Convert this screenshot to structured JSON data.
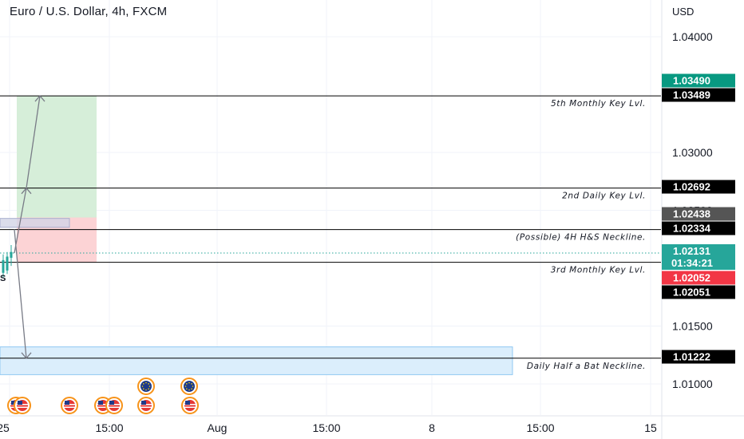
{
  "header": {
    "title": "Euro / U.S. Dollar, 4h, FXCM",
    "currency": "USD"
  },
  "chart_data": {
    "type": "line",
    "symbol": "Euro / U.S. Dollar, 4h, FXCM",
    "y_axis_label": "USD",
    "ylim": [
      1.0085,
      1.0445
    ],
    "y_ticks": [
      {
        "value": 1.04,
        "label": "1.04000"
      },
      {
        "value": 1.03,
        "label": "1.03000"
      },
      {
        "value": 1.025,
        "label": "1.02500"
      },
      {
        "value": 1.015,
        "label": "1.01500"
      },
      {
        "value": 1.01,
        "label": "1.01000"
      }
    ],
    "x_ticks": [
      "25",
      "15:00",
      "Aug",
      "15:00",
      "8",
      "15:00",
      "15"
    ],
    "horizontal_levels": [
      {
        "value": 1.03489,
        "label": "5th Monthly Key Lvl."
      },
      {
        "value": 1.02692,
        "label": "2nd Daily Key Lvl."
      },
      {
        "value": 1.02334,
        "label": "(Possible) 4H H&S Neckline."
      },
      {
        "value": 1.02051,
        "label": "3rd Monthly Key Lvl."
      },
      {
        "value": 1.01222,
        "label": "Daily Half a Bat Neckline."
      }
    ],
    "price_tags": [
      {
        "value": 1.0349,
        "label": "1.03490",
        "color": "#089981"
      },
      {
        "value": 1.03489,
        "label": "1.03489",
        "color": "#000000"
      },
      {
        "value": 1.02692,
        "label": "1.02692",
        "color": "#000000"
      },
      {
        "value": 1.02438,
        "label": "1.02438",
        "color": "#555555"
      },
      {
        "value": 1.02334,
        "label": "1.02334",
        "color": "#000000"
      },
      {
        "value": 1.02131,
        "label": "1.02131",
        "sublabel": "01:34:21",
        "color": "#26a69a"
      },
      {
        "value": 1.02052,
        "label": "1.02052",
        "color": "#f23645"
      },
      {
        "value": 1.02051,
        "label": "1.02051",
        "color": "#000000"
      },
      {
        "value": 1.01222,
        "label": "1.01222",
        "color": "#000000"
      }
    ],
    "current_price": 1.02131,
    "countdown": "01:34:21",
    "position": {
      "entry": 1.02438,
      "target": 1.03489,
      "stop": 1.02051
    },
    "zones": [
      {
        "name": "daily-half-bat-zone",
        "top": 1.0132,
        "bottom": 1.0108
      },
      {
        "name": "neckline-zone",
        "top": 1.0243,
        "bottom": 1.0236
      }
    ],
    "projection_path": [
      1.02131,
      1.02692,
      1.03489
    ],
    "down_projection": [
      1.02334,
      1.01222
    ],
    "partial_label": "S",
    "colors": {
      "profit": "#d6eed9",
      "loss": "#fcd3d5",
      "zone": "#dbeefc",
      "zone_border": "#90c8f2",
      "current": "#26a69a"
    },
    "event_icons": [
      "us",
      "us",
      "us",
      "us",
      "us",
      "eu",
      "eu",
      "us",
      "us"
    ]
  }
}
